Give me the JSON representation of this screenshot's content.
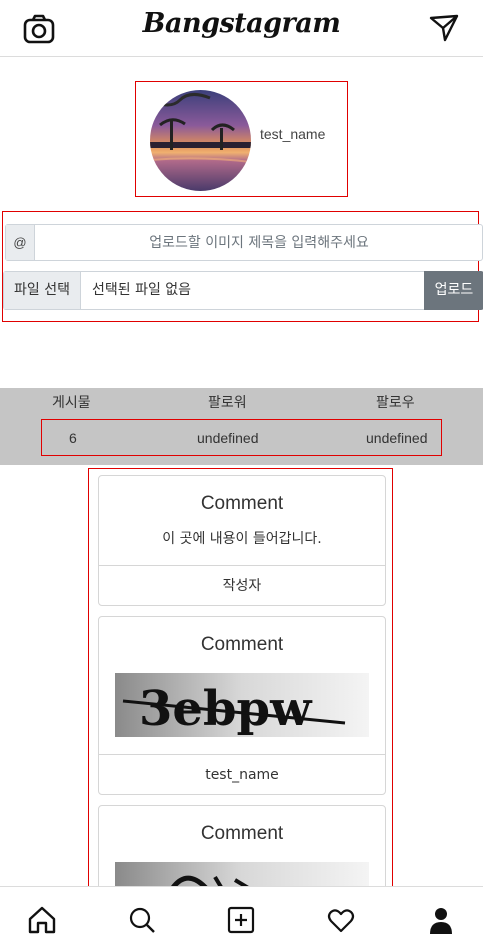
{
  "app": {
    "logo_text": "Bangstagram"
  },
  "header": {
    "left_icon": "camera-icon",
    "right_icon": "send-icon"
  },
  "profile": {
    "name": "test_name"
  },
  "upload": {
    "prefix": "@",
    "title_placeholder": "업로드할 이미지 제목을 입력해주세요",
    "file_button_label": "파일 선택",
    "file_status": "선택된 파일 없음",
    "upload_button_label": "업로드"
  },
  "stats": {
    "posts_label": "게시물",
    "followers_label": "팔로워",
    "following_label": "팔로우",
    "posts_value": "6",
    "followers_value": "undefined",
    "following_value": "undefined"
  },
  "feed": {
    "cards": [
      {
        "title": "Comment",
        "text": "이 곳에 내용이 들어갑니다.",
        "author": "작성자"
      },
      {
        "title": "Comment",
        "image_text": "3ebpw",
        "author": "test_name"
      },
      {
        "title": "Comment",
        "image_text": ""
      }
    ]
  },
  "nav": {
    "items": [
      "home-icon",
      "search-icon",
      "add-icon",
      "heart-icon",
      "profile-icon"
    ]
  },
  "colors": {
    "highlight_border": "#e00000",
    "stats_bg": "#c5c5c5",
    "button_bg": "#6c757d"
  }
}
